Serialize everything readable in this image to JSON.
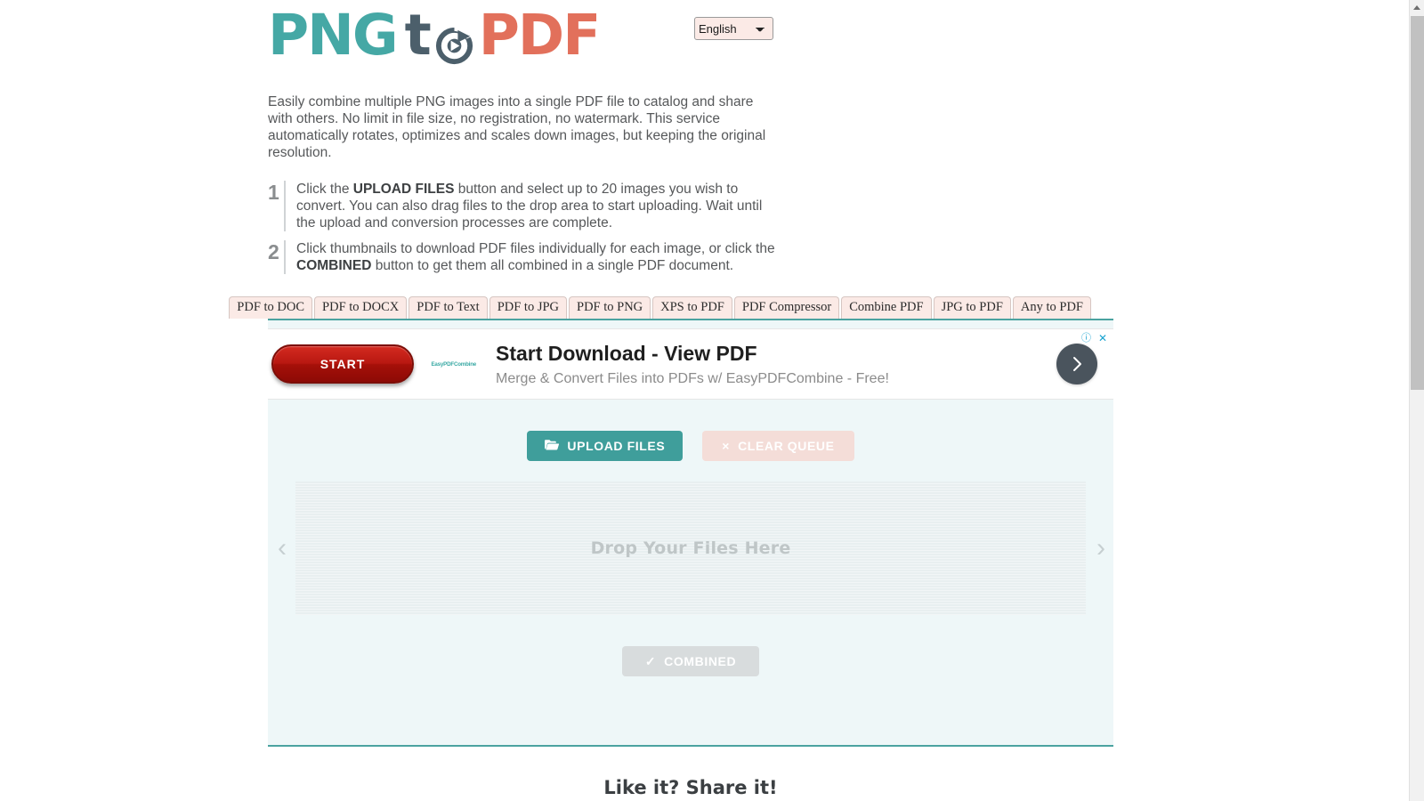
{
  "header": {
    "logo": {
      "part1": "PNG",
      "part2": "t",
      "mark": "circular-refresh-arrow",
      "part3": "PDF"
    },
    "language": {
      "selected": "English",
      "options": [
        "English"
      ]
    }
  },
  "intro": {
    "text": "Easily combine multiple PNG images into a single PDF file to catalog and share with others. No limit in file size, no registration, no watermark. This service automatically rotates, optimizes and scales down images, but keeping the original resolution."
  },
  "steps": [
    {
      "number": "1",
      "pre": "Click the ",
      "strong": "UPLOAD FILES",
      "post": " button and select up to 20 images you wish to convert. You can also drag files to the drop area to start uploading. Wait until the upload and conversion processes are complete."
    },
    {
      "number": "2",
      "pre": "Click thumbnails to download PDF files individually for each image, or click the ",
      "strong": "COMBINED",
      "post": " button to get them all combined in a single PDF document."
    }
  ],
  "tabs": [
    {
      "label": "PDF to DOC"
    },
    {
      "label": "PDF to DOCX"
    },
    {
      "label": "PDF to Text"
    },
    {
      "label": "PDF to JPG"
    },
    {
      "label": "PDF to PNG"
    },
    {
      "label": "XPS to PDF"
    },
    {
      "label": "PDF Compressor"
    },
    {
      "label": "Combine PDF"
    },
    {
      "label": "JPG to PDF"
    },
    {
      "label": "Any to PDF"
    }
  ],
  "ad": {
    "button_label": "START",
    "brand": "EasyPDFCombine",
    "title": "Start Download - View PDF",
    "subtitle": "Merge & Convert Files into PDFs w/ EasyPDFCombine - Free!",
    "arrow_icon": "chevron-right-icon",
    "adchoices_icon": "adchoices-info-icon",
    "close_icon": "close-x-icon",
    "adchoices_glyph": "ⓘ",
    "close_glyph": "✕"
  },
  "uploader": {
    "upload_label": "UPLOAD FILES",
    "upload_icon": "folder-open-icon",
    "clear_label": "CLEAR QUEUE",
    "clear_icon": "times-icon",
    "clear_glyph": "×",
    "dropzone_text": "Drop Your Files Here",
    "prev_glyph": "‹",
    "next_glyph": "›",
    "combined_label": "COMBINED",
    "combined_icon": "checkmark-icon",
    "combined_glyph": "✓"
  },
  "footer": {
    "share_title": "Like it? Share it!"
  },
  "colors": {
    "teal": "#45a8a5",
    "coral": "#e2705b",
    "slate": "#4c5f6b",
    "panel_bg": "#eef7f8",
    "tab_bg": "#fbeae6",
    "upload_btn": "#3f9e9b",
    "ad_red": "#b81811"
  }
}
